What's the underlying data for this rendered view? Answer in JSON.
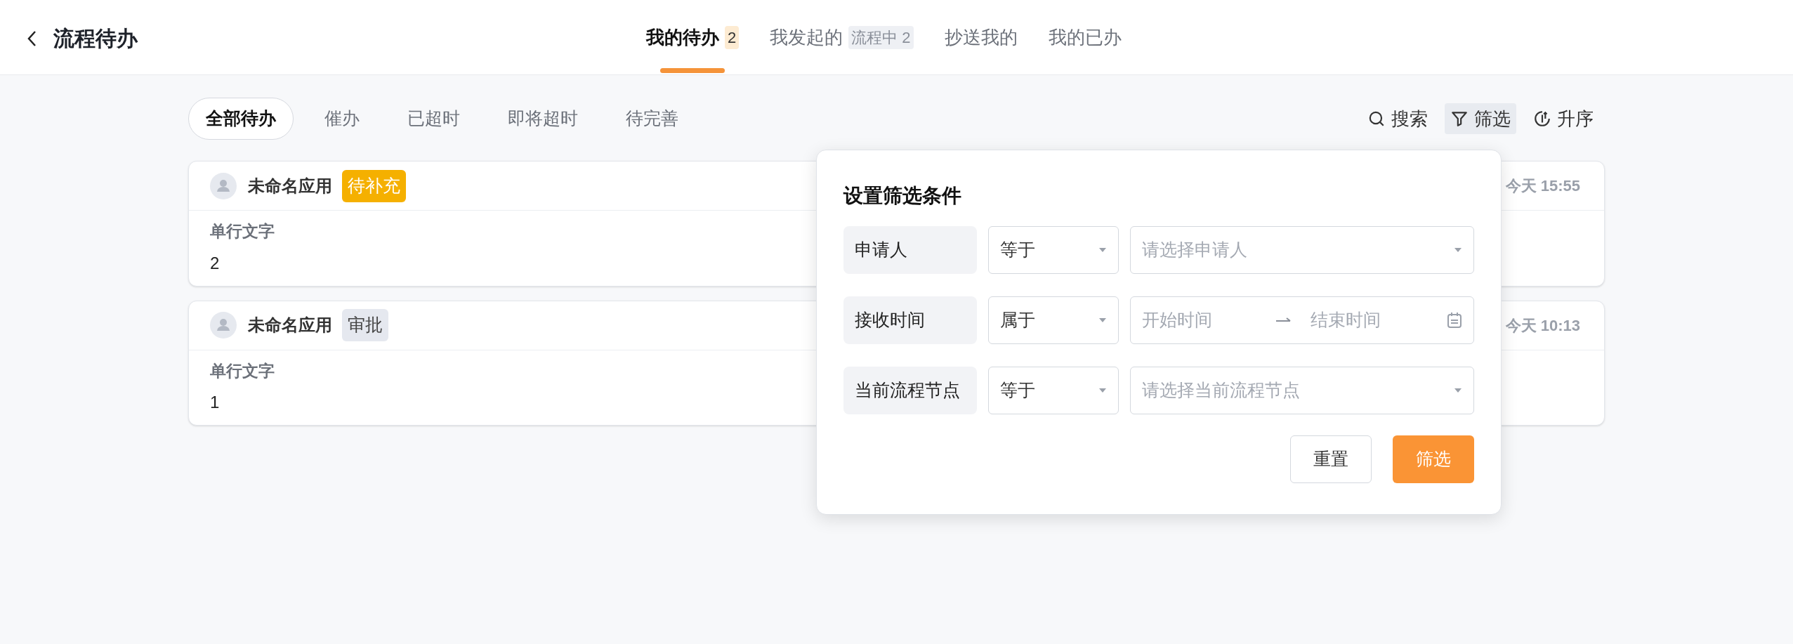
{
  "header": {
    "title": "流程待办"
  },
  "tabs": [
    {
      "label": "我的待办",
      "badge": "2",
      "kind": "highlight",
      "selected": true
    },
    {
      "label": "我发起的",
      "badge": "流程中 2",
      "kind": "muted",
      "selected": false
    },
    {
      "label": "抄送我的",
      "selected": false
    },
    {
      "label": "我的已办",
      "selected": false
    }
  ],
  "filters": [
    {
      "label": "全部待办",
      "selected": true
    },
    {
      "label": "催办",
      "selected": false
    },
    {
      "label": "已超时",
      "selected": false
    },
    {
      "label": "即将超时",
      "selected": false
    },
    {
      "label": "待完善",
      "selected": false
    }
  ],
  "toolbar": [
    {
      "label": "搜索",
      "kind": "search",
      "active": false
    },
    {
      "label": "筛选",
      "kind": "filter",
      "active": true
    },
    {
      "label": "升序",
      "kind": "sort",
      "active": false
    }
  ],
  "cards": [
    {
      "app": "未命名应用",
      "tag": "待补充",
      "color": "#f5b000",
      "time": "今天 15:55",
      "field_label": "单行文字",
      "field_value": "2"
    },
    {
      "app": "未命名应用",
      "tag": "审批",
      "color": "#e5e8ef",
      "time": "今天 10:13",
      "field_label": "单行文字",
      "field_value": "1"
    }
  ],
  "filter_popup": {
    "title": "设置筛选条件",
    "rows": [
      {
        "label": "申请人",
        "operator": "等于",
        "kind": "select",
        "placeholder": "请选择申请人"
      },
      {
        "label": "接收时间",
        "operator": "属于",
        "kind": "range",
        "start_placeholder": "开始时间",
        "end_placeholder": "结束时间"
      },
      {
        "label": "当前流程节点",
        "operator": "等于",
        "kind": "select",
        "placeholder": "请选择当前流程节点"
      }
    ],
    "reset_button": "重置",
    "submit_button": "筛选"
  }
}
